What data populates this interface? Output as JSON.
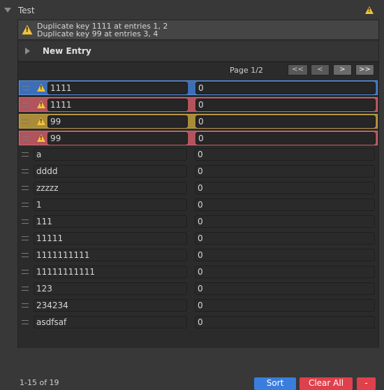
{
  "foldout": {
    "label": "Test",
    "warning_icon": "warning-icon"
  },
  "helpbox": {
    "lines": [
      "Duplicate key 1111 at entries 1, 2",
      "Duplicate key 99 at entries 3, 4"
    ]
  },
  "new_entry": {
    "label": "New Entry"
  },
  "pager": {
    "page_label": "Page 1/2",
    "first_label": "<<",
    "prev_label": "<",
    "next_label": ">",
    "last_label": ">>"
  },
  "entries": [
    {
      "key": "1111",
      "value": "0",
      "state": "selected",
      "warning": true
    },
    {
      "key": "1111",
      "value": "0",
      "state": "duplicate-red",
      "warning": true
    },
    {
      "key": "99",
      "value": "0",
      "state": "duplicate-yellow",
      "warning": true
    },
    {
      "key": "99",
      "value": "0",
      "state": "duplicate-red",
      "warning": true
    },
    {
      "key": "a",
      "value": "0",
      "state": "normal",
      "warning": false
    },
    {
      "key": "dddd",
      "value": "0",
      "state": "normal",
      "warning": false
    },
    {
      "key": "zzzzz",
      "value": "0",
      "state": "normal",
      "warning": false
    },
    {
      "key": "1",
      "value": "0",
      "state": "normal",
      "warning": false
    },
    {
      "key": "111",
      "value": "0",
      "state": "normal",
      "warning": false
    },
    {
      "key": "11111",
      "value": "0",
      "state": "normal",
      "warning": false
    },
    {
      "key": "1111111111",
      "value": "0",
      "state": "normal",
      "warning": false
    },
    {
      "key": "11111111111",
      "value": "0",
      "state": "normal",
      "warning": false
    },
    {
      "key": "123",
      "value": "0",
      "state": "normal",
      "warning": false
    },
    {
      "key": "234234",
      "value": "0",
      "state": "normal",
      "warning": false
    },
    {
      "key": "asdfsaf",
      "value": "0",
      "state": "normal",
      "warning": false
    }
  ],
  "footer": {
    "count_label": "1-15 of 19",
    "sort_label": "Sort",
    "clear_label": "Clear All",
    "remove_label": "-"
  },
  "colors": {
    "selected": "#3c6fb8",
    "duplicate_red": "#b3535c",
    "duplicate_yellow": "#a98b3a",
    "sort_button": "#3b7ddd",
    "danger_button": "#e0404c",
    "warning": "#f2c43a"
  }
}
